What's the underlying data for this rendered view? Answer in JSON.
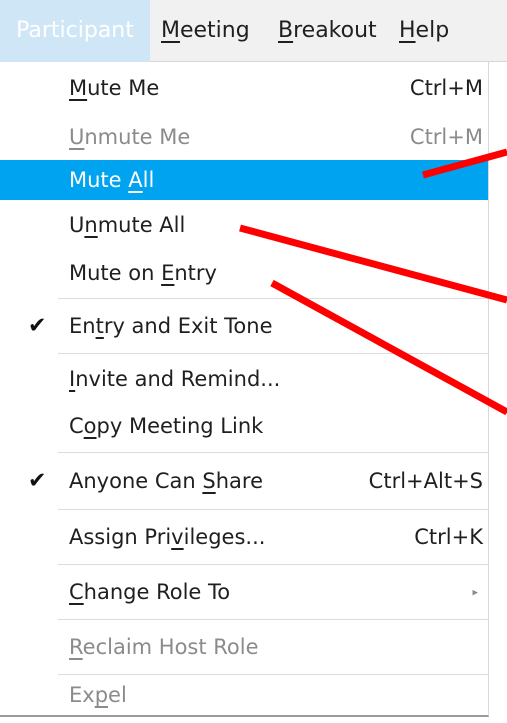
{
  "menubar": {
    "items": [
      {
        "pre": "",
        "key": "",
        "post": "Participant",
        "active": true
      },
      {
        "pre": "",
        "key": "M",
        "post": "eeting",
        "active": false
      },
      {
        "pre": "",
        "key": "B",
        "post": "reakout",
        "active": false
      },
      {
        "pre": "",
        "key": "H",
        "post": "elp",
        "active": false
      }
    ]
  },
  "dropdown": {
    "items": [
      {
        "pre": "",
        "key": "M",
        "post": "ute Me",
        "shortcut": "Ctrl+M"
      },
      {
        "pre": "",
        "key": "U",
        "post": "nmute Me",
        "shortcut": "Ctrl+M"
      },
      {
        "pre": "Mute ",
        "key": "A",
        "post": "ll",
        "shortcut": ""
      },
      {
        "pre": "U",
        "key": "n",
        "post": "mute All",
        "shortcut": ""
      },
      {
        "pre": "Mute on ",
        "key": "E",
        "post": "ntry",
        "shortcut": ""
      },
      {
        "pre": "En",
        "key": "t",
        "post": "ry and Exit Tone",
        "shortcut": "",
        "check": "✔"
      },
      {
        "pre": "",
        "key": "I",
        "post": "nvite and Remind...",
        "shortcut": ""
      },
      {
        "pre": "C",
        "key": "o",
        "post": "py Meeting Link",
        "shortcut": ""
      },
      {
        "pre": "Anyone Can ",
        "key": "S",
        "post": "hare",
        "shortcut": "Ctrl+Alt+S",
        "check": "✔"
      },
      {
        "pre": "Assign Pri",
        "key": "v",
        "post": "ileges...",
        "shortcut": "Ctrl+K"
      },
      {
        "pre": "",
        "key": "C",
        "post": "hange Role To",
        "shortcut": "",
        "arrow": "▸"
      },
      {
        "pre": "",
        "key": "R",
        "post": "eclaim Host Role",
        "shortcut": ""
      },
      {
        "pre": "Ex",
        "key": "p",
        "post": "el",
        "shortcut": ""
      }
    ]
  },
  "colors": {
    "highlight": "#00a3f0",
    "annotation_arrow": "#ff0000",
    "disabled_text": "#8b8b8b"
  }
}
